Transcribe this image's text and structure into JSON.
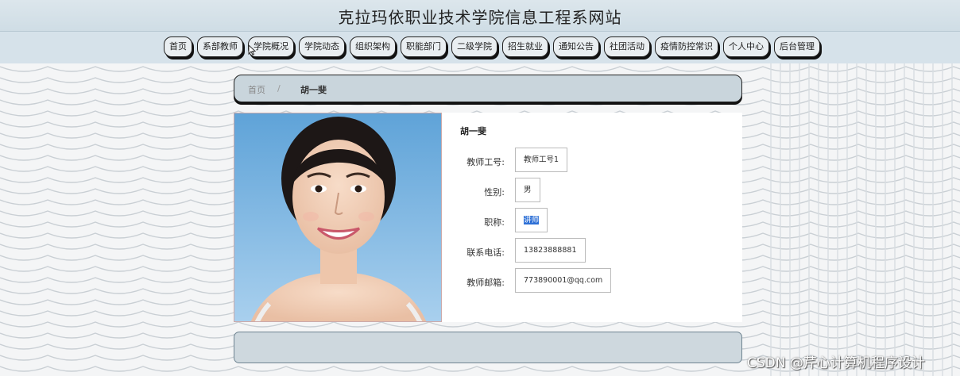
{
  "header": {
    "title": "克拉玛依职业技术学院信息工程系网站"
  },
  "nav": {
    "items": [
      {
        "label": "首页"
      },
      {
        "label": "系部教师"
      },
      {
        "label": "学院概况"
      },
      {
        "label": "学院动态"
      },
      {
        "label": "组织架构"
      },
      {
        "label": "职能部门"
      },
      {
        "label": "二级学院"
      },
      {
        "label": "招生就业"
      },
      {
        "label": "通知公告"
      },
      {
        "label": "社团活动"
      },
      {
        "label": "疫情防控常识"
      },
      {
        "label": "个人中心"
      },
      {
        "label": "后台管理"
      }
    ]
  },
  "breadcrumb": {
    "home": "首页",
    "separator": "/",
    "current": "胡一斐"
  },
  "teacher": {
    "name": "胡一斐",
    "fields": {
      "id": {
        "label": "教师工号:",
        "value": "教师工号1"
      },
      "gender": {
        "label": "性别:",
        "value": "男"
      },
      "title": {
        "label": "职称:",
        "value": "讲师"
      },
      "phone": {
        "label": "联系电话:",
        "value": "13823888881"
      },
      "email": {
        "label": "教师邮箱:",
        "value": "773890001@qq.com"
      }
    }
  },
  "watermark": "CSDN @芹心计算机程序设计",
  "colors": {
    "header_bg": "#d6e2ea",
    "breadcrumb_bg": "#c9d5dc",
    "selection": "#2c6fd6"
  }
}
